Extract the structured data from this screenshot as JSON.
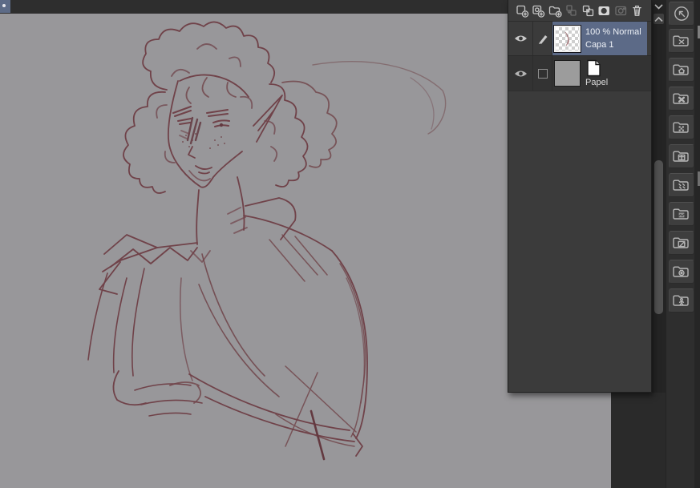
{
  "colors": {
    "canvas_bg": "#98979a",
    "sketch_stroke": "#6b3940",
    "sketch_stroke_dark": "#5d2f36",
    "panel_bg": "#3b3b3b",
    "selected_row_bg": "#5c6a87",
    "app_bg": "#2e2e2e",
    "sidebar_bg": "#2e2e2e",
    "tab_fragment": "#5d6b87"
  },
  "layers_panel": {
    "toolbar_icons": [
      {
        "name": "new-raster-layer",
        "enabled": true
      },
      {
        "name": "new-vector-layer",
        "enabled": true
      },
      {
        "name": "new-layer-folder",
        "enabled": true
      },
      {
        "name": "transfer-to-lower-layer",
        "enabled": false
      },
      {
        "name": "merge-to-lower-layer",
        "enabled": true
      },
      {
        "name": "create-layer-mask",
        "enabled": true
      },
      {
        "name": "apply-mask",
        "enabled": false
      },
      {
        "name": "delete-layer",
        "enabled": true
      }
    ],
    "rows": [
      {
        "name": "Capa 1",
        "opacity_blend": "100 % Normal",
        "visible": true,
        "editing": true,
        "selected": true,
        "thumbnail": "transparent-checkerboard-with-sketch"
      },
      {
        "name": "Papel",
        "visible": true,
        "selected": false,
        "thumbnail": "solid-gray",
        "type_icon": "paper-layer"
      }
    ]
  },
  "scroll_strip": {
    "icons": [
      "chevron-down-icon",
      "chevron-up-icon"
    ],
    "scrollbar": true
  },
  "sidebar": {
    "buttons": [
      {
        "icon": "quick-access-icon"
      },
      {
        "icon": "material-folder-x-icon"
      },
      {
        "icon": "material-folder-home-icon"
      },
      {
        "icon": "material-folder-x-bold-icon"
      },
      {
        "icon": "material-folder-pattern-icon"
      },
      {
        "icon": "material-folder-grid-icon"
      },
      {
        "icon": "material-folder-scatter-icon"
      },
      {
        "icon": "material-folder-image-icon"
      },
      {
        "icon": "material-folder-edit-icon"
      },
      {
        "icon": "material-folder-camera-icon"
      },
      {
        "icon": "material-folder-figure-icon"
      }
    ]
  }
}
